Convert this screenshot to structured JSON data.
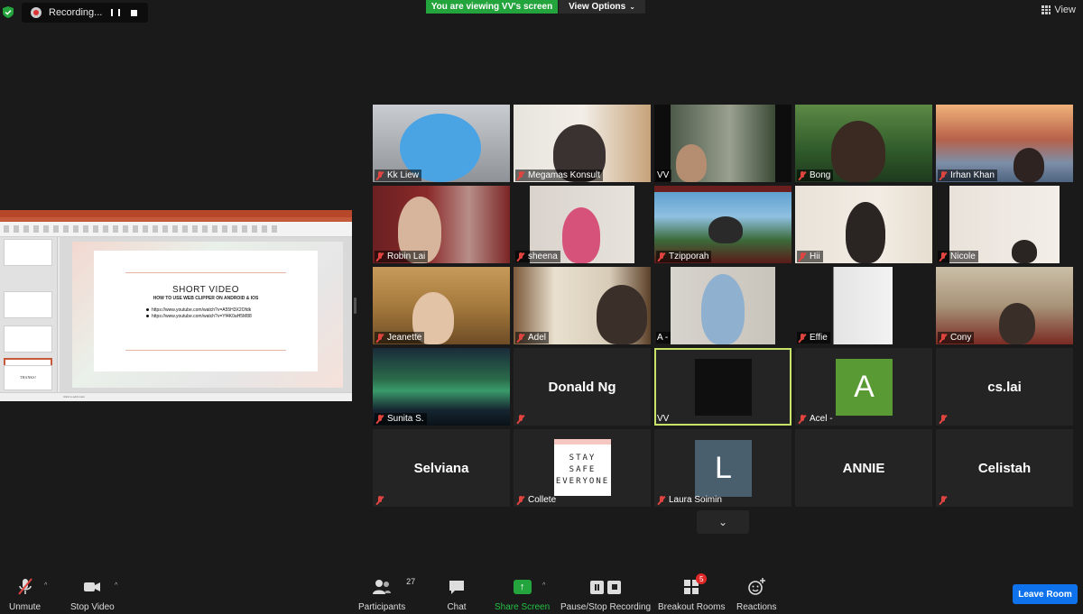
{
  "top_bar": {
    "recording_label": "Recording...",
    "viewing_banner": "You are viewing VV's screen",
    "view_options_label": "View Options",
    "view_label": "View"
  },
  "shared_screen": {
    "slide_title": "SHORT VIDEO",
    "slide_subtitle": "HOW TO USE WEB CLIPPER ON ANDROID & IOS",
    "links": [
      "https://www.youtube.com/watch?v=A55H3X2Ofdk",
      "https://www.youtube.com/watch?v=Yf4K0aH5M88"
    ],
    "thumb_last_label": "THANKS!",
    "status_text": "Click to add notes"
  },
  "participants": [
    {
      "name": "Kk Liew",
      "muted": true
    },
    {
      "name": "Megamas Konsult",
      "muted": true
    },
    {
      "name": "VV",
      "muted": false
    },
    {
      "name": "Bong",
      "muted": true
    },
    {
      "name": "Irhan Khan",
      "muted": true
    },
    {
      "name": "Robin Lai",
      "muted": true
    },
    {
      "name": "sheena",
      "muted": true
    },
    {
      "name": "Tzipporah",
      "muted": true
    },
    {
      "name": "Hii",
      "muted": true
    },
    {
      "name": "Nicole",
      "muted": true
    },
    {
      "name": "Jeanette",
      "muted": true
    },
    {
      "name": "Adel",
      "muted": true
    },
    {
      "name": "A -",
      "muted": false
    },
    {
      "name": "Effie",
      "muted": true
    },
    {
      "name": "Cony",
      "muted": true
    },
    {
      "name": "Sunita S.",
      "muted": true
    },
    {
      "name": "Donald Ng",
      "muted": true
    },
    {
      "name": "VV",
      "muted": false
    },
    {
      "name": "Acel -",
      "muted": true
    },
    {
      "name": "cs.lai",
      "muted": true
    },
    {
      "name": "Selviana",
      "muted": true
    },
    {
      "name": "Collete",
      "muted": true
    },
    {
      "name": "Laura Soimin",
      "muted": true
    },
    {
      "name": "ANNIE",
      "muted": true
    },
    {
      "name": "Celistah",
      "muted": true
    }
  ],
  "avatars": {
    "acel_initial": "A",
    "laura_initial": "L",
    "acel_color": "#5a9a35",
    "laura_color": "#4a5f6e",
    "stay_safe": [
      "STAY",
      "SAFE",
      "EVERYONE"
    ]
  },
  "toolbar": {
    "unmute": "Unmute",
    "stop_video": "Stop Video",
    "participants": "Participants",
    "participants_count": "27",
    "chat": "Chat",
    "share_screen": "Share Screen",
    "pause_stop": "Pause/Stop Recording",
    "breakout": "Breakout Rooms",
    "breakout_badge": "5",
    "reactions": "Reactions",
    "leave": "Leave Room"
  },
  "colors": {
    "accent_green": "#23a43c",
    "leave_blue": "#0e72ed",
    "active_speaker": "#c8e36a",
    "mute_red": "#e0443f"
  }
}
